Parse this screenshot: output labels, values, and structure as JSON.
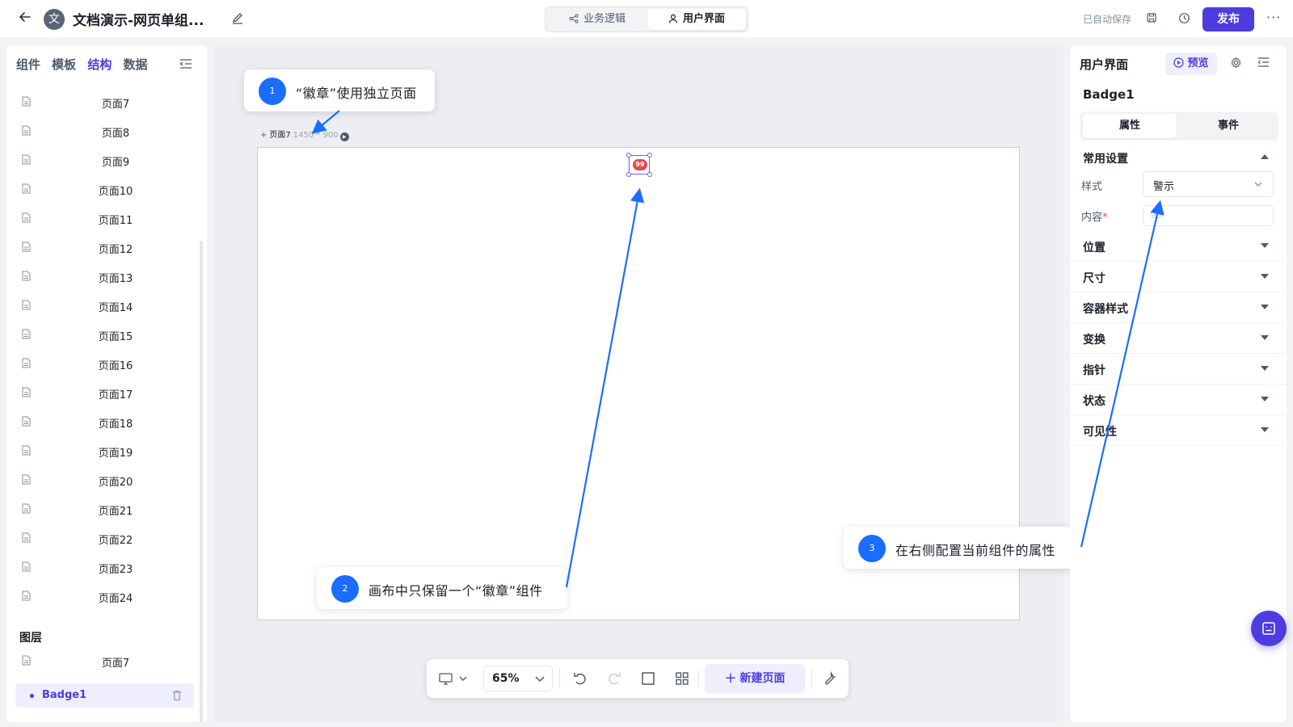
{
  "header": {
    "back_icon": "arrow-left-icon",
    "app_avatar": "文",
    "app_title": "文档演示-网页单组...",
    "mode_tabs": [
      "业务逻辑",
      "用户界面"
    ],
    "autosave": "已自动保存",
    "publish_label": "发布",
    "more_label": "···"
  },
  "left_panel": {
    "tabs": [
      "组件",
      "模板",
      "结构",
      "数据"
    ],
    "active_tab": "结构",
    "pages": [
      "页面7",
      "页面8",
      "页面9",
      "页面10",
      "页面11",
      "页面12",
      "页面13",
      "页面14",
      "页面15",
      "页面16",
      "页面17",
      "页面18",
      "页面19",
      "页面20",
      "页面21",
      "页面22",
      "页面23",
      "页面24"
    ],
    "layers_title": "图层",
    "layer_page": "页面7",
    "layer_selected": "Badge1"
  },
  "canvas": {
    "artboard_name": "页面7",
    "artboard_size": "1450 * 900",
    "badge_value": "99",
    "callouts": [
      {
        "num": "1",
        "text": "“徽章”使用独立页面"
      },
      {
        "num": "2",
        "text": "画布中只保留一个“徽章”组件"
      },
      {
        "num": "3",
        "text": "在右侧配置当前组件的属性"
      }
    ]
  },
  "bottom_toolbar": {
    "zoom": "65%",
    "new_page_label": "新建页面"
  },
  "right_panel": {
    "title": "用户界面",
    "preview_label": "预览",
    "component_name": "Badge1",
    "prop_tabs": [
      "属性",
      "事件"
    ],
    "common_settings": "常用设置",
    "style_label": "样式",
    "style_value": "警示",
    "content_label": "内容",
    "content_required": "*",
    "content_value": "99",
    "sections": [
      "位置",
      "尺寸",
      "容器样式",
      "变换",
      "指针",
      "状态",
      "可见性"
    ]
  },
  "colors": {
    "accent": "#4d3ce0",
    "callout_blue": "#1a6dff",
    "badge_red": "#e5484d"
  }
}
